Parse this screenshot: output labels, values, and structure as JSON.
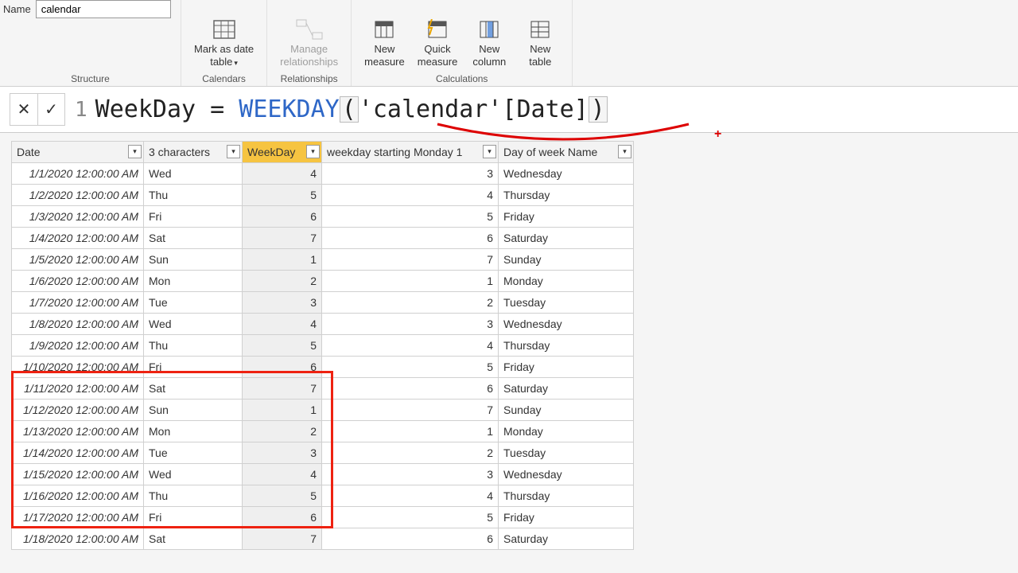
{
  "ribbon": {
    "name_label": "Name",
    "name_value": "calendar",
    "groups": {
      "structure": "Structure",
      "calendars": "Calendars",
      "relationships": "Relationships",
      "calculations": "Calculations"
    },
    "buttons": {
      "mark_date": "Mark as date\ntable",
      "manage_rel": "Manage\nrelationships",
      "new_measure": "New\nmeasure",
      "quick_measure": "Quick\nmeasure",
      "new_column": "New\ncolumn",
      "new_table": "New\ntable"
    }
  },
  "formula": {
    "line": "1",
    "lhs": "WeekDay ",
    "eq": "= ",
    "fn": "WEEKDAY",
    "arg": "'calendar'[Date]"
  },
  "columns": {
    "date": "Date",
    "ch3": "3 characters",
    "wd": "WeekDay",
    "mon": "weekday starting Monday 1",
    "name": "Day of week Name"
  },
  "rows": [
    {
      "date": "1/1/2020 12:00:00 AM",
      "ch3": "Wed",
      "wd": "4",
      "mon": "3",
      "name": "Wednesday"
    },
    {
      "date": "1/2/2020 12:00:00 AM",
      "ch3": "Thu",
      "wd": "5",
      "mon": "4",
      "name": "Thursday"
    },
    {
      "date": "1/3/2020 12:00:00 AM",
      "ch3": "Fri",
      "wd": "6",
      "mon": "5",
      "name": "Friday"
    },
    {
      "date": "1/4/2020 12:00:00 AM",
      "ch3": "Sat",
      "wd": "7",
      "mon": "6",
      "name": "Saturday"
    },
    {
      "date": "1/5/2020 12:00:00 AM",
      "ch3": "Sun",
      "wd": "1",
      "mon": "7",
      "name": "Sunday"
    },
    {
      "date": "1/6/2020 12:00:00 AM",
      "ch3": "Mon",
      "wd": "2",
      "mon": "1",
      "name": "Monday"
    },
    {
      "date": "1/7/2020 12:00:00 AM",
      "ch3": "Tue",
      "wd": "3",
      "mon": "2",
      "name": "Tuesday"
    },
    {
      "date": "1/8/2020 12:00:00 AM",
      "ch3": "Wed",
      "wd": "4",
      "mon": "3",
      "name": "Wednesday"
    },
    {
      "date": "1/9/2020 12:00:00 AM",
      "ch3": "Thu",
      "wd": "5",
      "mon": "4",
      "name": "Thursday"
    },
    {
      "date": "1/10/2020 12:00:00 AM",
      "ch3": "Fri",
      "wd": "6",
      "mon": "5",
      "name": "Friday"
    },
    {
      "date": "1/11/2020 12:00:00 AM",
      "ch3": "Sat",
      "wd": "7",
      "mon": "6",
      "name": "Saturday"
    },
    {
      "date": "1/12/2020 12:00:00 AM",
      "ch3": "Sun",
      "wd": "1",
      "mon": "7",
      "name": "Sunday"
    },
    {
      "date": "1/13/2020 12:00:00 AM",
      "ch3": "Mon",
      "wd": "2",
      "mon": "1",
      "name": "Monday"
    },
    {
      "date": "1/14/2020 12:00:00 AM",
      "ch3": "Tue",
      "wd": "3",
      "mon": "2",
      "name": "Tuesday"
    },
    {
      "date": "1/15/2020 12:00:00 AM",
      "ch3": "Wed",
      "wd": "4",
      "mon": "3",
      "name": "Wednesday"
    },
    {
      "date": "1/16/2020 12:00:00 AM",
      "ch3": "Thu",
      "wd": "5",
      "mon": "4",
      "name": "Thursday"
    },
    {
      "date": "1/17/2020 12:00:00 AM",
      "ch3": "Fri",
      "wd": "6",
      "mon": "5",
      "name": "Friday"
    },
    {
      "date": "1/18/2020 12:00:00 AM",
      "ch3": "Sat",
      "wd": "7",
      "mon": "6",
      "name": "Saturday"
    }
  ]
}
